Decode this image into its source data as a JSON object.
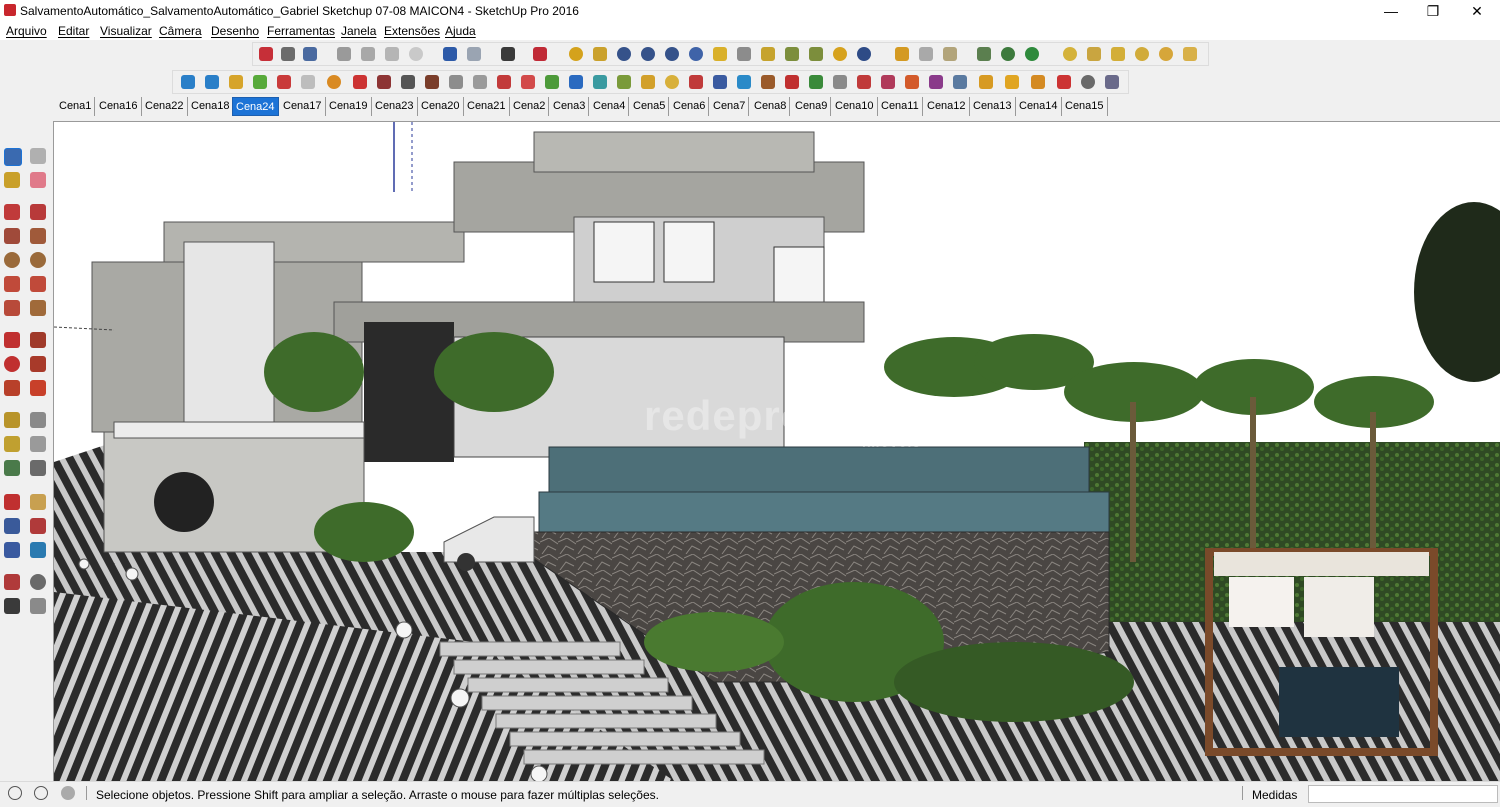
{
  "window": {
    "title": "SalvamentoAutomático_SalvamentoAutomático_Gabriel Sketchup 07-08 MAICON4 - SketchUp Pro 2016",
    "minimize": "—",
    "restore": "❐",
    "close": "✕"
  },
  "menu": [
    "Arquivo",
    "Editar",
    "Visualizar",
    "Câmera",
    "Desenho",
    "Ferramentas",
    "Janela",
    "Extensões",
    "Ajuda"
  ],
  "scenes": {
    "tabs": [
      "Cena1",
      "Cena16",
      "Cena22",
      "Cena18",
      "Cena24",
      "Cena17",
      "Cena19",
      "Cena23",
      "Cena20",
      "Cena21",
      "Cena2",
      "Cena3",
      "Cena4",
      "Cena5",
      "Cena6",
      "Cena7",
      "Cena8",
      "Cena9",
      "Cena10",
      "Cena11",
      "Cena12",
      "Cena13",
      "Cena14",
      "Cena15"
    ],
    "active": "Cena24"
  },
  "viewport": {
    "watermark_brand": "redeprovectum",
    "watermark_sub": "imóveis"
  },
  "status": {
    "hint": "Selecione objetos. Pressione Shift para ampliar a seleção. Arraste o mouse para fazer múltiplas seleções.",
    "measure_label": "Medidas",
    "measure_value": ""
  },
  "colors": {
    "accent": "#1c73d6",
    "sky": "#ffffff",
    "concrete": "#a9a9a4",
    "pool": "#4d6f78",
    "gabion": "#3d3a37",
    "foliage": "#3e6b2a"
  }
}
